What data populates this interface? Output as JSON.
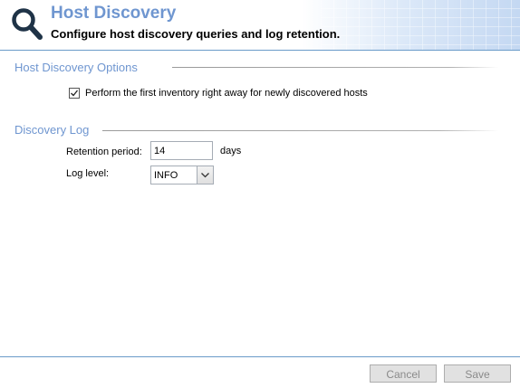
{
  "header": {
    "title": "Host Discovery",
    "subtitle": "Configure host discovery queries and log retention.",
    "icon": "search-icon"
  },
  "options_section": {
    "heading": "Host Discovery Options",
    "first_inventory": {
      "label": "Perform the first inventory right away for newly discovered hosts",
      "checked": true
    }
  },
  "log_section": {
    "heading": "Discovery Log",
    "retention": {
      "label": "Retention period:",
      "value": "14",
      "unit": "days"
    },
    "log_level": {
      "label": "Log level:",
      "value": "INFO"
    }
  },
  "footer": {
    "cancel_label": "Cancel",
    "save_label": "Save"
  },
  "colors": {
    "accent": "#6f96d0",
    "divider": "#6a9bc9"
  }
}
